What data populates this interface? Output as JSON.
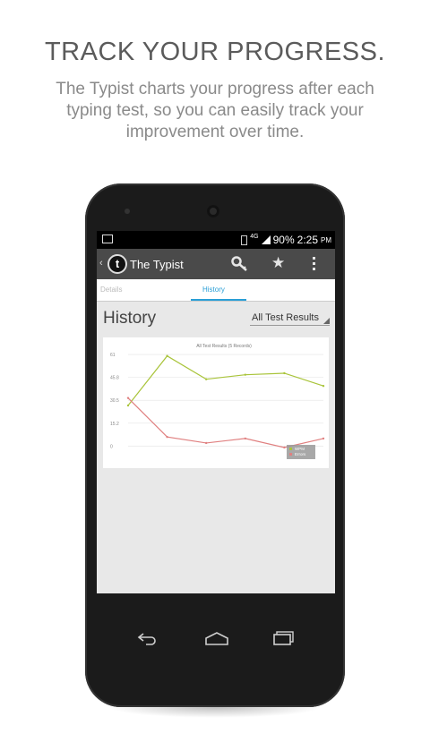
{
  "promo": {
    "headline": "TRACK YOUR PROGRESS.",
    "subline": "The Typist charts your progress after each typing test, so you can easily track your improvement over time."
  },
  "statusbar": {
    "network": "4G",
    "battery": "90%",
    "time": "2:25",
    "ampm": "PM"
  },
  "actionbar": {
    "app_title": "The Typist",
    "logo_letter": "t",
    "icons": [
      "key-icon",
      "star-icon",
      "overflow-menu-icon"
    ]
  },
  "tabs": [
    {
      "label": "Details",
      "active": false
    },
    {
      "label": "History",
      "active": true
    }
  ],
  "history": {
    "title": "History",
    "filter": "All Test Results"
  },
  "chart_data": {
    "type": "line",
    "title": "All Test Results (5 Records)",
    "x": [
      1,
      2,
      3,
      4,
      5,
      6
    ],
    "y_ticks": [
      0,
      15.2,
      30.5,
      45.8,
      61
    ],
    "ylim": [
      -4,
      64
    ],
    "series": [
      {
        "name": "WPM",
        "color": "#a9c43a",
        "values": [
          27,
          60,
          44.5,
          47.5,
          48.5,
          40
        ]
      },
      {
        "name": "Errors",
        "color": "#e08080",
        "values": [
          32,
          6,
          2,
          5,
          -1,
          5
        ]
      }
    ],
    "legend": "bottom-right",
    "grid": true
  },
  "colors": {
    "accent": "#2a9fd6",
    "actionbar": "#4a4a4a"
  }
}
